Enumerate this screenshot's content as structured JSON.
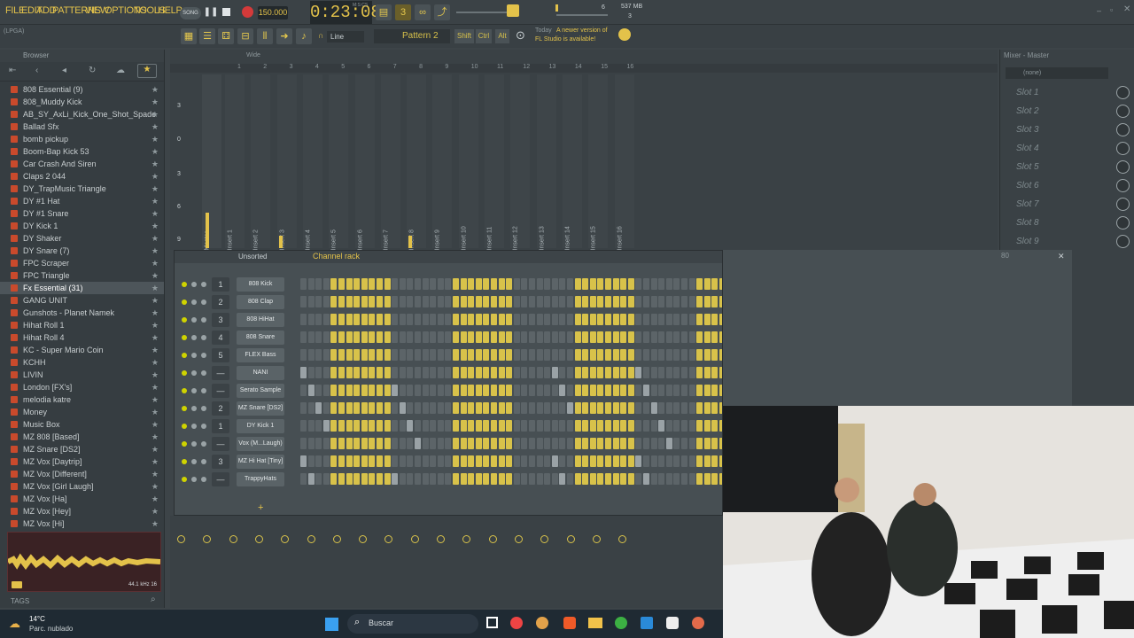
{
  "menu": [
    "FILE",
    "EDIT",
    "ADD",
    "PATTERNS",
    "VIEW",
    "OPTIONS",
    "TOOLS",
    "HELP"
  ],
  "transport": {
    "mode": "SONG",
    "tempo": "150.000",
    "time": "0:23:08",
    "time_unit": "M:S:CS",
    "memory": "537 MB",
    "cpu_val": "6",
    "poly_val": "3"
  },
  "toolbar2": {
    "snap": "Line",
    "pattern": "Pattern 2",
    "shift": "Shift",
    "ctrl": "Ctrl",
    "alt": "Alt",
    "news_day": "Today",
    "news_text1": "A newer version of",
    "news_text2": "FL Studio is available!",
    "hint": "(LPGA)"
  },
  "browser": {
    "title": "Browser",
    "items": [
      "808 Essential (9)",
      "808_Muddy Kick",
      "AB_SY_AxLi_Kick_One_Shot_Spade",
      "Ballad Sfx",
      "bomb pickup",
      "Boom-Bap Kick 53",
      "Car Crash And Siren",
      "Claps 2 044",
      "DY_TrapMusic Triangle",
      "DY #1 Hat",
      "DY #1 Snare",
      "DY Kick 1",
      "DY Shaker",
      "DY Snare (7)",
      "FPC Scraper",
      "FPC Triangle",
      "Fx Essential (31)",
      "GANG UNIT",
      "Gunshots - Planet Namek",
      "Hihat Roll 1",
      "Hihat Roll 4",
      "KC - Super Mario Coin",
      "KCHH",
      "LIVIN",
      "London [FX's]",
      "melodia katre",
      "Money",
      "Music Box",
      "MZ 808 [Based]",
      "MZ Snare [DS2]",
      "MZ Vox [Daytrip]",
      "MZ Vox [Different]",
      "MZ Vox [Girl Laugh]",
      "MZ Vox [Ha]",
      "MZ Vox [Hey]",
      "MZ Vox [Hi]"
    ],
    "selected": 16,
    "sample_info": "44.1 kHz 16",
    "tags": "TAGS"
  },
  "playlist": {
    "mode": "Wide",
    "ruler": [
      "1",
      "2",
      "3",
      "4",
      "5",
      "6",
      "7",
      "8",
      "9",
      "10",
      "11",
      "12",
      "13",
      "14",
      "15",
      "16"
    ],
    "db": [
      "3",
      "0",
      "3",
      "6",
      "9"
    ],
    "inserts": [
      "Master",
      "Insert 1",
      "Insert 2",
      "Insert 3",
      "Insert 4",
      "Insert 5",
      "Insert 6",
      "Insert 7",
      "Insert 8",
      "Insert 9",
      "Insert 10",
      "Insert 11",
      "Insert 12",
      "Insert 13",
      "Insert 14",
      "Insert 15",
      "Insert 16"
    ]
  },
  "mixer_right": {
    "title": "Mixer - Master",
    "none": "(none)",
    "slots": [
      "Slot 1",
      "Slot 2",
      "Slot 3",
      "Slot 4",
      "Slot 5",
      "Slot 6",
      "Slot 7",
      "Slot 8",
      "Slot 9"
    ]
  },
  "channel_rack": {
    "title": "Channel rack",
    "filter": "Unsorted",
    "swing": "80",
    "channels": [
      {
        "num": "1",
        "name": "808 Kick"
      },
      {
        "num": "2",
        "name": "808 Clap"
      },
      {
        "num": "3",
        "name": "808 HiHat"
      },
      {
        "num": "4",
        "name": "808 Snare"
      },
      {
        "num": "5",
        "name": "FLEX Bass"
      },
      {
        "num": "—",
        "name": "NANI"
      },
      {
        "num": "—",
        "name": "Serato Sample"
      },
      {
        "num": "2",
        "name": "MZ Snare [DS2]"
      },
      {
        "num": "1",
        "name": "DY Kick 1"
      },
      {
        "num": "—",
        "name": "Vox (M...Laugh)"
      },
      {
        "num": "3",
        "name": "MZ Hi Hat [Tiny]"
      },
      {
        "num": "—",
        "name": "TrappyHats"
      }
    ]
  },
  "taskbar": {
    "temp": "14°C",
    "weather": "Parc. nublado",
    "search": "Buscar"
  },
  "colors": {
    "accent": "#e3c24a",
    "step_on": "#d8c24a",
    "bg": "#3d4448"
  }
}
